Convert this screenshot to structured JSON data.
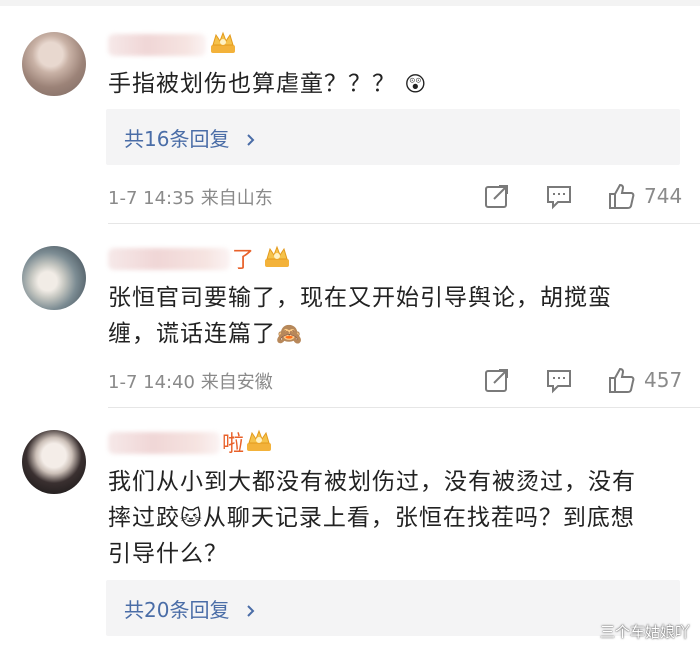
{
  "comments": [
    {
      "name_tail": "",
      "text": "手指被划伤也算虐童？？？",
      "emoji": "😲",
      "reply_link": "共16条回复",
      "meta": "1-7 14:35 来自山东",
      "likes": "744"
    },
    {
      "name_tail": "了",
      "text_line1": "张恒官司要输了，现在又开始引导舆论，胡搅蛮",
      "text_line2": "缠，谎话连篇了",
      "emoji": "🙈",
      "meta": "1-7 14:40 来自安徽",
      "likes": "457"
    },
    {
      "name_tail": "啦",
      "text_line1": "我们从小到大都没有被划伤过，没有被烫过，没有",
      "text_line2a": "摔过跤",
      "emoji": "🐱",
      "text_line2b": "从聊天记录上看，张恒在找茬吗？到底想",
      "text_line3": "引导什么？",
      "reply_link": "共20条回复"
    }
  ],
  "watermark": "三个车姑娘吖",
  "icons": {
    "crown": "crown-badge-icon",
    "share": "share-icon",
    "comment": "comment-icon",
    "like": "thumbs-up-icon",
    "chevron": "chevron-right-icon"
  }
}
